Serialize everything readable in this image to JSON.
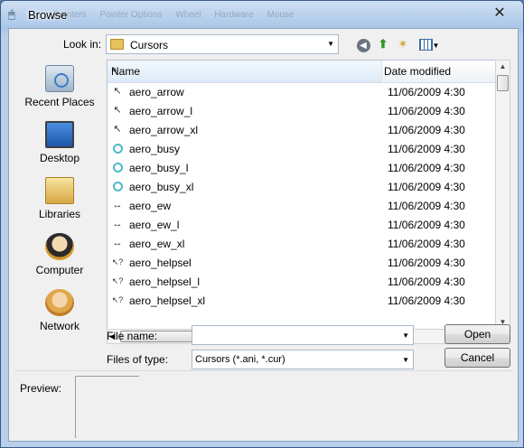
{
  "window": {
    "title": "Browse",
    "close_label": "✕",
    "background_tabs": [
      "Pointers",
      "Pointer Options",
      "Wheel",
      "Hardware",
      "Mouse"
    ]
  },
  "lookin": {
    "label": "Look in:",
    "value": "Cursors"
  },
  "toolbar": {
    "back_icon": "back-arrow-icon",
    "up_icon": "up-folder-icon",
    "new_folder_icon": "new-folder-icon",
    "view_icon": "view-menu-icon"
  },
  "places": [
    {
      "label": "Recent Places",
      "icon": "recent-places-icon"
    },
    {
      "label": "Desktop",
      "icon": "desktop-icon"
    },
    {
      "label": "Libraries",
      "icon": "libraries-icon"
    },
    {
      "label": "Computer",
      "icon": "computer-icon"
    },
    {
      "label": "Network",
      "icon": "network-icon"
    }
  ],
  "filelist": {
    "columns": [
      "Name",
      "Date modified"
    ],
    "rows": [
      {
        "name": "aero_arrow",
        "date": "11/06/2009 4:30",
        "icon": "arrow-cursor-icon"
      },
      {
        "name": "aero_arrow_l",
        "date": "11/06/2009 4:30",
        "icon": "arrow-cursor-icon"
      },
      {
        "name": "aero_arrow_xl",
        "date": "11/06/2009 4:30",
        "icon": "arrow-cursor-icon"
      },
      {
        "name": "aero_busy",
        "date": "11/06/2009 4:30",
        "icon": "busy-cursor-icon"
      },
      {
        "name": "aero_busy_l",
        "date": "11/06/2009 4:30",
        "icon": "busy-cursor-icon"
      },
      {
        "name": "aero_busy_xl",
        "date": "11/06/2009 4:30",
        "icon": "busy-cursor-icon"
      },
      {
        "name": "aero_ew",
        "date": "11/06/2009 4:30",
        "icon": "resize-ew-cursor-icon"
      },
      {
        "name": "aero_ew_l",
        "date": "11/06/2009 4:30",
        "icon": "resize-ew-cursor-icon"
      },
      {
        "name": "aero_ew_xl",
        "date": "11/06/2009 4:30",
        "icon": "resize-ew-cursor-icon"
      },
      {
        "name": "aero_helpsel",
        "date": "11/06/2009 4:30",
        "icon": "help-cursor-icon"
      },
      {
        "name": "aero_helpsel_l",
        "date": "11/06/2009 4:30",
        "icon": "help-cursor-icon"
      },
      {
        "name": "aero_helpsel_xl",
        "date": "11/06/2009 4:30",
        "icon": "help-cursor-icon"
      }
    ]
  },
  "filename": {
    "label": "File name:",
    "value": ""
  },
  "filetype": {
    "label": "Files of type:",
    "value": "Cursors (*.ani, *.cur)"
  },
  "buttons": {
    "open": "Open",
    "cancel": "Cancel"
  },
  "preview": {
    "label": "Preview:"
  }
}
